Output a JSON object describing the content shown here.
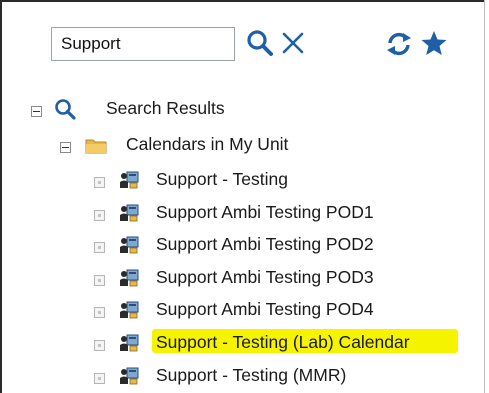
{
  "toolbar": {
    "search_value": "Support",
    "search_icon": "search-icon",
    "clear_icon": "close-icon",
    "refresh_icon": "refresh-icon",
    "favorite_icon": "star-icon"
  },
  "tree": {
    "root": {
      "label": "Search Results",
      "icon": "search-icon",
      "expanded": true
    },
    "group": {
      "label": "Calendars in My Unit",
      "icon": "folder-icon",
      "expanded": true
    },
    "items": [
      {
        "label": "Support - Testing",
        "icon": "calendar-resource-icon"
      },
      {
        "label": "Support Ambi Testing POD1",
        "icon": "calendar-resource-icon"
      },
      {
        "label": "Support Ambi Testing POD2",
        "icon": "calendar-resource-icon"
      },
      {
        "label": "Support Ambi Testing POD3",
        "icon": "calendar-resource-icon"
      },
      {
        "label": "Support Ambi Testing POD4",
        "icon": "calendar-resource-icon"
      },
      {
        "label": "Support - Testing (Lab) Calendar",
        "icon": "calendar-resource-icon",
        "highlighted": true
      },
      {
        "label": "Support - Testing (MMR)",
        "icon": "calendar-resource-icon"
      }
    ]
  },
  "colors": {
    "accent_icon": "#1f5fa8",
    "highlight": "#f6f300",
    "folder": "#e7b84a"
  }
}
